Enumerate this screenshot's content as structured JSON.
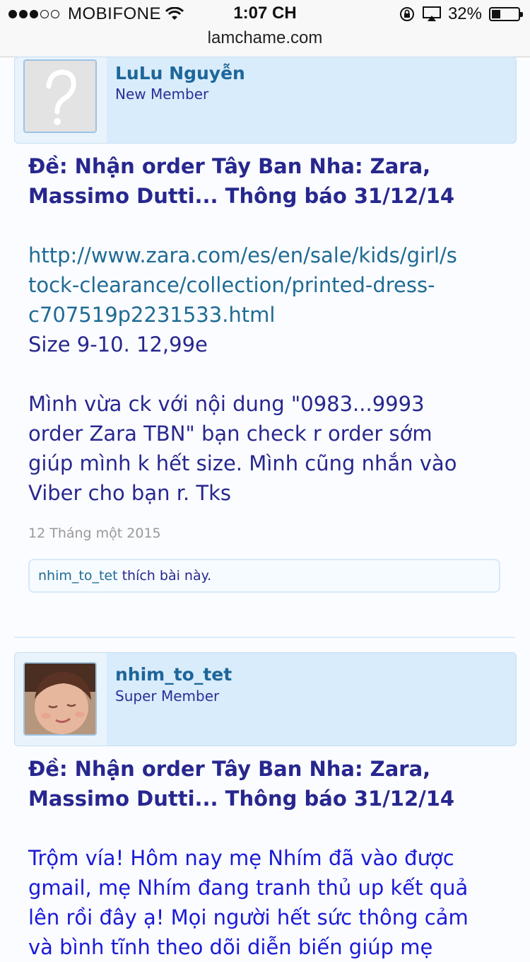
{
  "status_bar": {
    "carrier": "MOBIFONE",
    "time": "1:07 CH",
    "battery": "32%",
    "battery_level": 0.32,
    "url": "lamchame.com"
  },
  "posts": [
    {
      "username": "LuLu Nguyễn",
      "user_title": "New Member",
      "title_line1": "Đề: Nhận order Tây Ban Nha: Zara,",
      "title_line2": "Massimo Dutti... Thông báo 31/12/14",
      "link_line1": "http://www.zara.com/es/en/sale/kids/girl/s",
      "link_line2": "tock-clearance/collection/printed-dress-",
      "link_line3": "c707519p2231533.html",
      "size_line": "Size 9-10. 12,99e",
      "body_line1": "Mình vừa ck với nội dung \"0983...9993",
      "body_line2": "order Zara TBN\" bạn check r order sớm",
      "body_line3": "giúp mình k hết size. Mình cũng nhắn vào",
      "body_line4": "Viber cho bạn r. Tks",
      "date": "12 Tháng một 2015",
      "liker": "nhim_to_tet",
      "likes_suffix": " thích bài này."
    },
    {
      "username": "nhim_to_tet",
      "user_title": "Super Member",
      "title_line1": "Đề: Nhận order Tây Ban Nha: Zara,",
      "title_line2": "Massimo Dutti... Thông báo 31/12/14",
      "body_line1": "Trộm vía! Hôm nay mẹ Nhím đã vào được",
      "body_line2": "gmail, mẹ Nhím đang tranh thủ up kết quả",
      "body_line3": "lên rồi đây ạ! Mọi người hết sức thông cảm",
      "body_line4": "và bình tĩnh theo dõi diễn biến giúp mẹ"
    }
  ],
  "colors": {
    "accent": "#27278f",
    "link": "#1f6b94",
    "author_bg": "#d9ecfb"
  }
}
